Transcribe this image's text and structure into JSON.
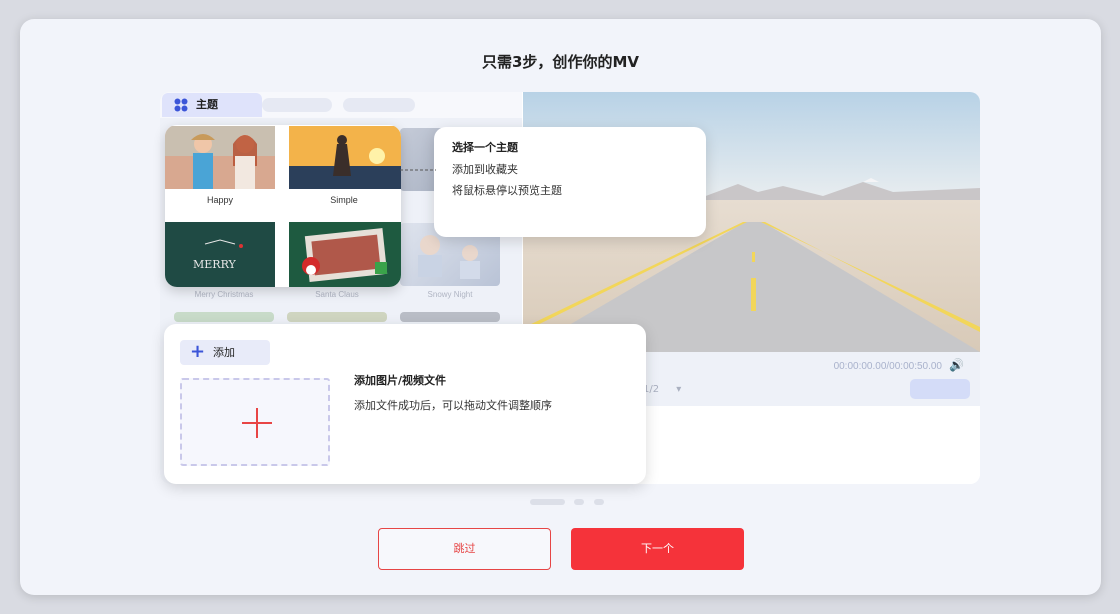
{
  "dialog": {
    "title": "只需3步，创作你的MV"
  },
  "tabs": {
    "theme_label": "主题"
  },
  "themes": [
    {
      "name": "Happy"
    },
    {
      "name": "Simple"
    },
    {
      "name": "Merry Christmas"
    },
    {
      "name": "Santa Claus"
    },
    {
      "name": "Snowy Night"
    }
  ],
  "tooltip_theme": {
    "title": "选择一个主题",
    "line1": "添加到收藏夹",
    "line2": "将鼠标悬停以预览主题"
  },
  "add_card": {
    "button_label": "添加",
    "title": "添加图片/视频文件",
    "desc": "添加文件成功后，可以拖动文件调整顺序"
  },
  "player": {
    "time": "00:00:00.00/00:00:50.00",
    "page": "1/2"
  },
  "footer": {
    "skip_label": "跳过",
    "next_label": "下一个"
  },
  "colors": {
    "accent_red": "#f5333a",
    "accent_blue": "#3b55d8"
  }
}
